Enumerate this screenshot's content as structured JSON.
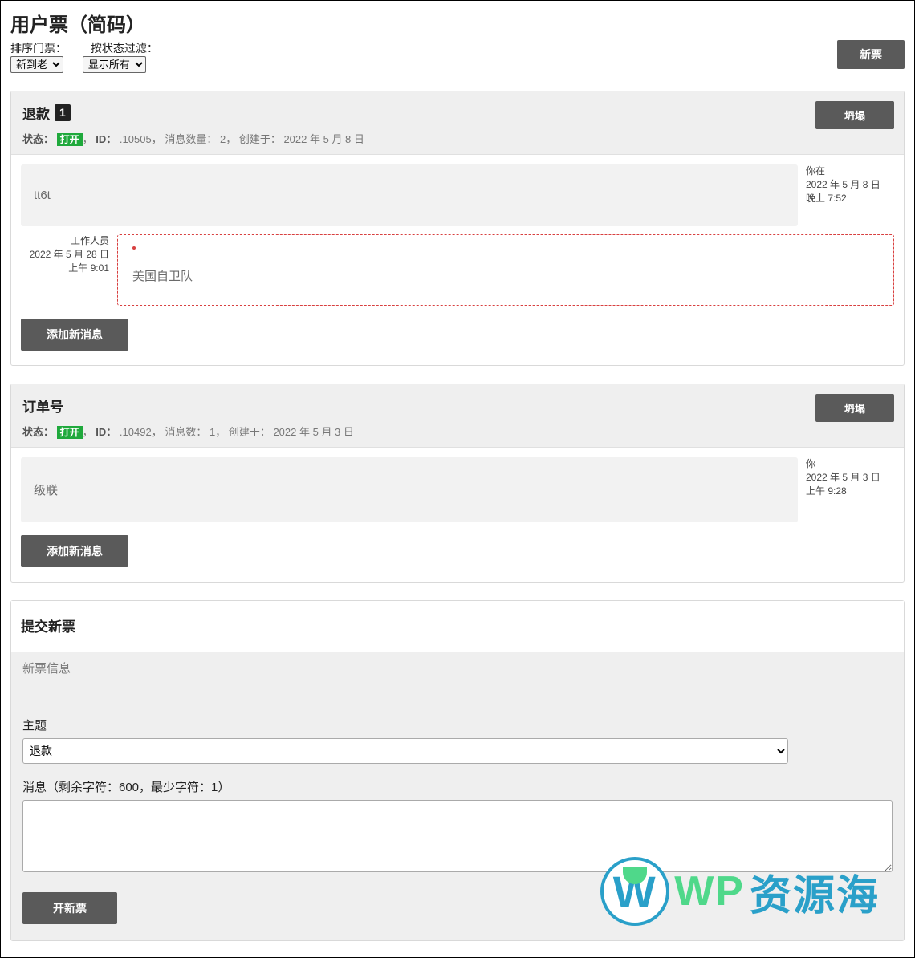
{
  "page": {
    "title": "用户票（简码）",
    "sort_label": "排序门票：",
    "filter_label": "按状态过滤：",
    "sort_value": "新到老",
    "filter_value": "显示所有",
    "new_ticket_btn": "新票"
  },
  "tickets": [
    {
      "title": "退款",
      "unread": "1",
      "collapse": "坍塌",
      "status_label": "状态：",
      "status_value": "打开",
      "id_label": "ID：",
      "id_value": ".10505",
      "msgcount_label": "消息数量：",
      "msgcount_value": "2",
      "created_label": "创建于：",
      "created_value": "2022 年 5 月 8 日",
      "messages": [
        {
          "body": "tt6t",
          "side": "right",
          "author": "你在",
          "date": "2022 年 5 月 8 日",
          "time": "晚上 7:52"
        },
        {
          "body": "美国自卫队",
          "side": "left",
          "author": "工作人员",
          "date": "2022 年 5 月 28 日",
          "time": "上午 9:01",
          "staff": true
        }
      ],
      "add_btn": "添加新消息"
    },
    {
      "title": "订单号",
      "collapse": "坍塌",
      "status_label": "状态：",
      "status_value": "打开",
      "id_label": "ID：",
      "id_value": ".10492",
      "msgcount_label": "消息数：",
      "msgcount_value": "1",
      "created_label": "创建于：",
      "created_value": "2022 年 5 月 3 日",
      "messages": [
        {
          "body": "级联",
          "side": "right",
          "author": "你",
          "date": "2022 年 5 月 3 日",
          "time": "上午 9:28"
        }
      ],
      "add_btn": "添加新消息"
    }
  ],
  "new_ticket": {
    "section_title": "提交新票",
    "info_label": "新票信息",
    "subject_label": "主题",
    "subject_value": "退款",
    "message_label": "消息（剩余字符：600，最少字符：1）",
    "submit_btn": "开新票"
  },
  "watermark": {
    "w": "W",
    "t1": "WP",
    "t2": "资源海"
  }
}
